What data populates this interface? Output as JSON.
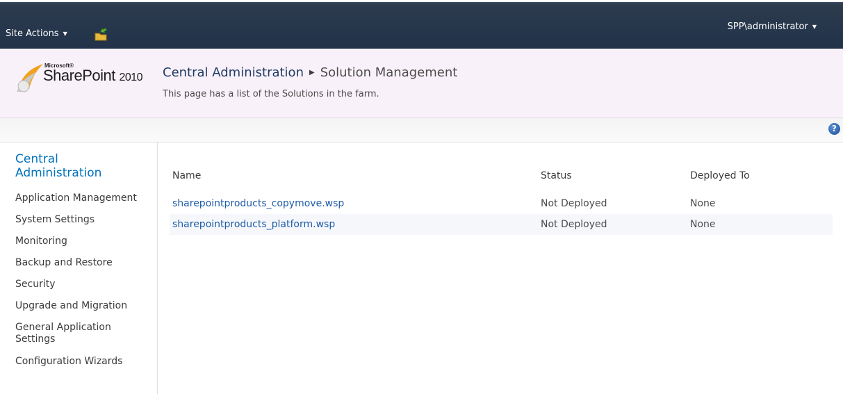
{
  "topbar": {
    "site_actions": "Site Actions",
    "user": "SPP\\administrator"
  },
  "logo": {
    "microsoft": "Microsoft®",
    "product": "SharePoint",
    "year": "2010"
  },
  "header": {
    "breadcrumb_root": "Central Administration",
    "breadcrumb_current": "Solution Management",
    "description": "This page has a list of the Solutions in the farm."
  },
  "leftnav": {
    "heading": "Central Administration",
    "items": [
      {
        "label": "Application Management"
      },
      {
        "label": "System Settings"
      },
      {
        "label": "Monitoring"
      },
      {
        "label": "Backup and Restore"
      },
      {
        "label": "Security"
      },
      {
        "label": "Upgrade and Migration"
      },
      {
        "label": "General Application Settings"
      },
      {
        "label": "Configuration Wizards"
      }
    ]
  },
  "table": {
    "columns": {
      "name": "Name",
      "status": "Status",
      "deployed_to": "Deployed To"
    },
    "rows": [
      {
        "name": "sharepointproducts_copymove.wsp",
        "status": "Not Deployed",
        "deployed_to": "None"
      },
      {
        "name": "sharepointproducts_platform.wsp",
        "status": "Not Deployed",
        "deployed_to": "None"
      }
    ]
  },
  "icons": {
    "navigate_up": "navigate-up-icon",
    "help": "help-icon",
    "dropdown": "chevron-down-icon"
  },
  "colors": {
    "topbar": "#21324a",
    "title_area": "#f9f1f9",
    "link": "#1e5ca8",
    "nav_heading": "#0072bc"
  }
}
